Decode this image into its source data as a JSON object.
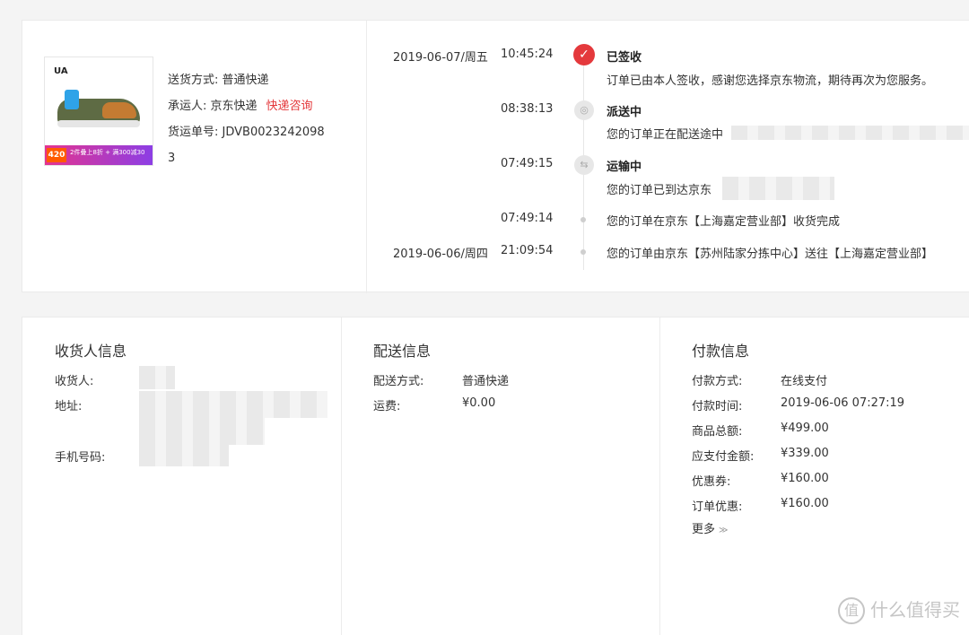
{
  "product": {
    "brand_mark": "UA",
    "promo_price": "420",
    "promo_text": "2件叠上8折 + 满300减30"
  },
  "shipping": {
    "method_label": "送货方式:",
    "method_value": "普通快递",
    "carrier_label": "承运人:",
    "carrier_value": "京东快递",
    "carrier_link": "快递咨询",
    "waybill_label": "货运单号:",
    "waybill_value_line1": "JDVB0023242098",
    "waybill_value_line2": "3"
  },
  "timeline": [
    {
      "date": "2019-06-07/周五",
      "time": "10:45:24",
      "title": "已签收",
      "desc": "订单已由本人签收，感谢您选择京东物流，期待再次为您服务。"
    },
    {
      "date": "",
      "time": "08:38:13",
      "title": "派送中",
      "desc": "您的订单正在配送途中"
    },
    {
      "date": "",
      "time": "07:49:15",
      "title": "运输中",
      "desc": "您的订单已到达京东"
    },
    {
      "date": "",
      "time": "07:49:14",
      "title": "",
      "desc": "您的订单在京东【上海嘉定营业部】收货完成"
    },
    {
      "date": "2019-06-06/周四",
      "time": "21:09:54",
      "title": "",
      "desc": "您的订单由京东【苏州陆家分拣中心】送往【上海嘉定营业部】"
    }
  ],
  "receiver": {
    "title": "收货人信息",
    "name_label": "收货人:",
    "address_label": "地址:",
    "phone_label": "手机号码:"
  },
  "delivery": {
    "title": "配送信息",
    "method_label": "配送方式:",
    "method_value": "普通快递",
    "fee_label": "运费:",
    "fee_value": "¥0.00"
  },
  "payment": {
    "title": "付款信息",
    "rows": [
      {
        "label": "付款方式:",
        "value": "在线支付"
      },
      {
        "label": "付款时间:",
        "value": "2019-06-06 07:27:19"
      },
      {
        "label": "商品总额:",
        "value": "¥499.00"
      },
      {
        "label": "应支付金额:",
        "value": "¥339.00"
      },
      {
        "label": "优惠券:",
        "value": "¥160.00"
      },
      {
        "label": "订单优惠:",
        "value": "¥160.00"
      }
    ],
    "more_label": "更多"
  },
  "watermark": {
    "badge": "值",
    "text": "什么值得买"
  },
  "colors": {
    "accent": "#e4393c",
    "background": "#f4f4f4"
  }
}
